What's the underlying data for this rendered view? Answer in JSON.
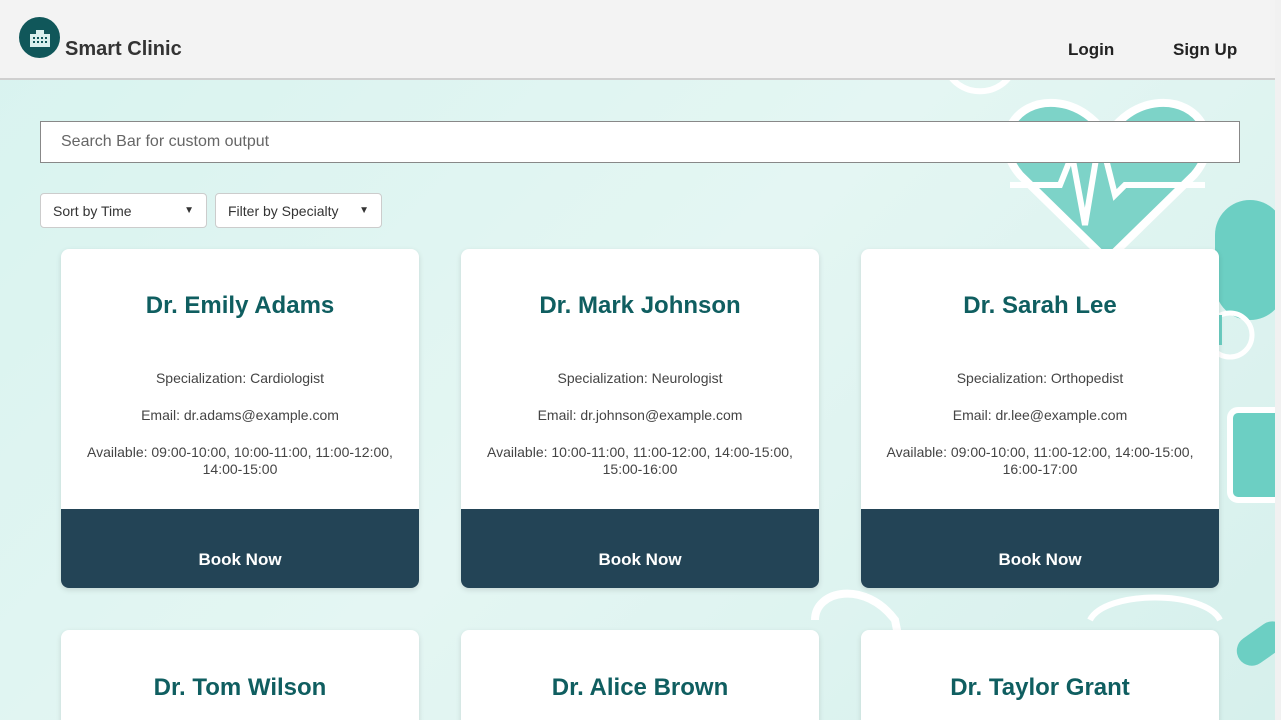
{
  "header": {
    "brand": "Smart Clinic",
    "logo_icon": "hospital-icon",
    "nav": {
      "login": "Login",
      "signup": "Sign Up"
    }
  },
  "search": {
    "placeholder": "Search Bar for custom output",
    "value": ""
  },
  "filters": {
    "sort": {
      "selected": "Sort by Time"
    },
    "specialty": {
      "selected": "Filter by Specialty"
    }
  },
  "doctors": [
    {
      "name": "Dr. Emily Adams",
      "specialization": "Specialization: Cardiologist",
      "email": "Email: dr.adams@example.com",
      "available_line1": "Available: 09:00-10:00, 10:00-11:00, 11:00-12:00,",
      "available_line2": "14:00-15:00",
      "book": "Book Now"
    },
    {
      "name": "Dr. Mark Johnson",
      "specialization": "Specialization: Neurologist",
      "email": "Email: dr.johnson@example.com",
      "available_line1": "Available: 10:00-11:00, 11:00-12:00, 14:00-15:00,",
      "available_line2": "15:00-16:00",
      "book": "Book Now"
    },
    {
      "name": "Dr. Sarah Lee",
      "specialization": "Specialization: Orthopedist",
      "email": "Email: dr.lee@example.com",
      "available_line1": "Available: 09:00-10:00, 11:00-12:00, 14:00-15:00,",
      "available_line2": "16:00-17:00",
      "book": "Book Now"
    },
    {
      "name": "Dr. Tom Wilson"
    },
    {
      "name": "Dr. Alice Brown"
    },
    {
      "name": "Dr. Taylor Grant"
    }
  ],
  "colors": {
    "brand_teal": "#0f5e60",
    "book_button": "#234456",
    "background": "#d8f3ef"
  }
}
